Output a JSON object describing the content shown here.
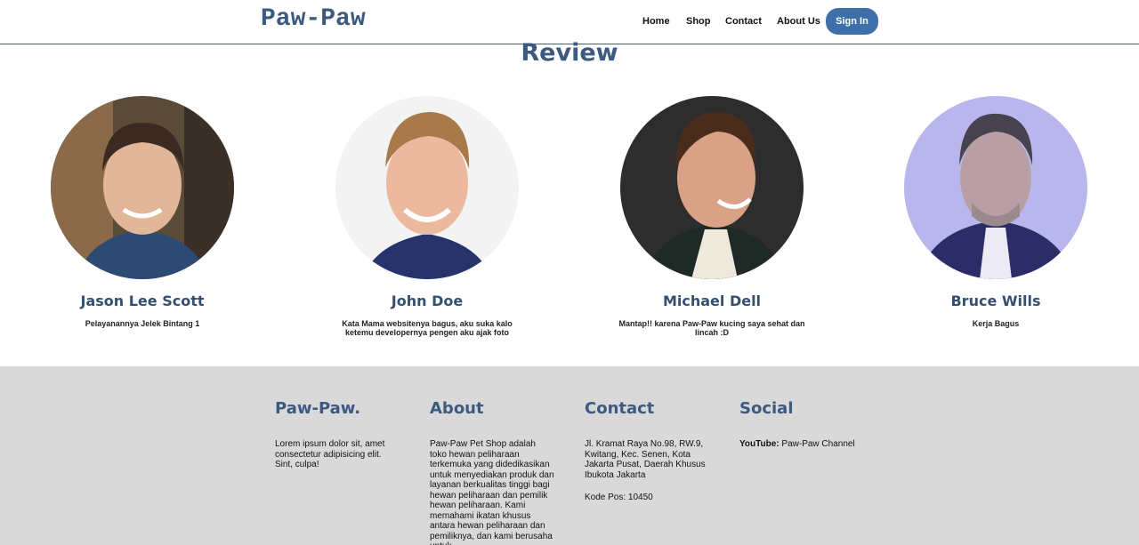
{
  "header": {
    "logo": "Paw-Paw",
    "nav": {
      "home": "Home",
      "shop": "Shop",
      "contact": "Contact",
      "about": "About Us"
    },
    "signin": "Sign In"
  },
  "review": {
    "title": "Review",
    "cards": [
      {
        "name": "Jason Lee Scott",
        "text": "Pelayanannya Jelek Bintang 1"
      },
      {
        "name": "John Doe",
        "text": "Kata Mama websitenya bagus, aku suka kalo ketemu developernya pengen aku ajak foto"
      },
      {
        "name": "Michael Dell",
        "text": "Mantap!! karena Paw-Paw kucing saya sehat dan lincah :D"
      },
      {
        "name": "Bruce Wills",
        "text": "Kerja Bagus"
      }
    ]
  },
  "footer": {
    "brand": {
      "title": "Paw-Paw.",
      "text": "Lorem ipsum dolor sit, amet consectetur adipisicing elit. Sint, culpa!"
    },
    "about": {
      "title": "About",
      "text": "Paw-Paw Pet Shop adalah toko hewan peliharaan terkemuka yang didedikasikan untuk menyediakan produk dan layanan berkualitas tinggi bagi hewan peliharaan dan pemilik hewan peliharaan. Kami memahami ikatan khusus antara hewan peliharaan dan pemiliknya, dan kami berusaha untuk"
    },
    "contact": {
      "title": "Contact",
      "address": "Jl. Kramat Raya No.98, RW.9, Kwitang, Kec. Senen, Kota Jakarta Pusat, Daerah Khusus Ibukota Jakarta",
      "postal": "Kode Pos: 10450"
    },
    "social": {
      "title": "Social",
      "label": "YouTube:",
      "value": "Paw-Paw Channel"
    }
  },
  "colors": {
    "brand": "#3c5a80",
    "button": "#3e6fa8",
    "footer_bg": "#d9d9d9"
  }
}
